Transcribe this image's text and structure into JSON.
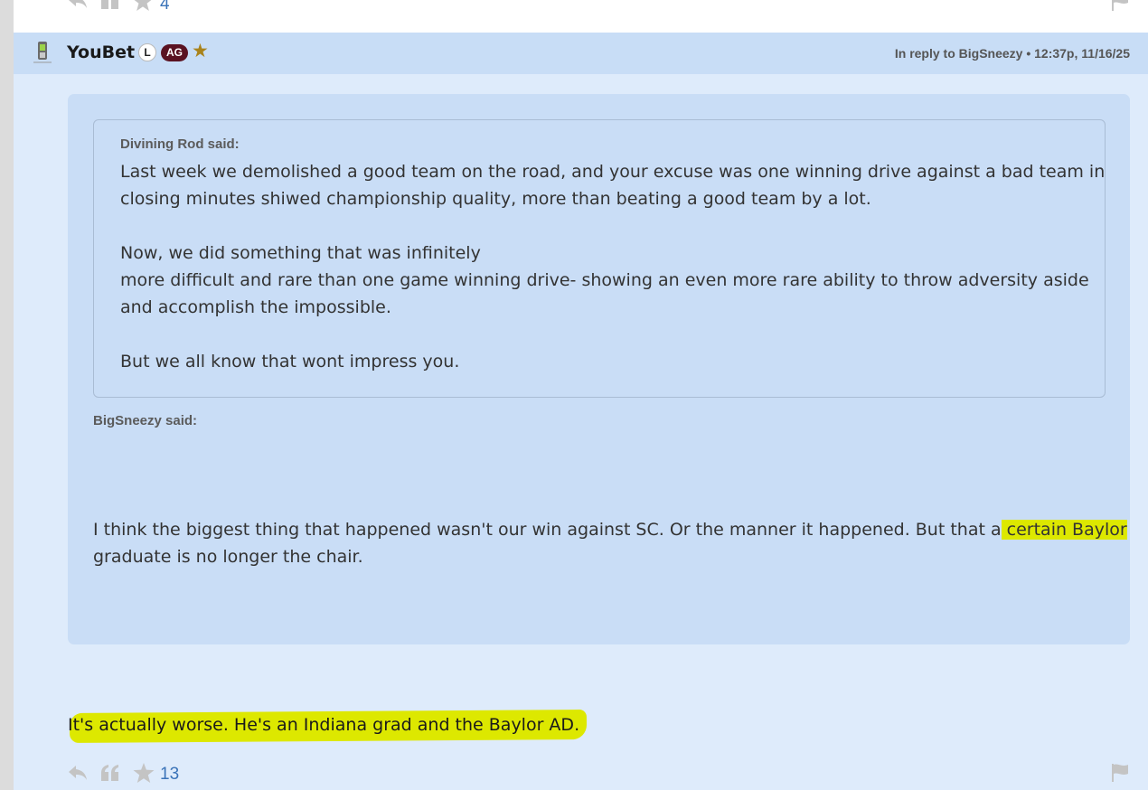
{
  "previous_post": {
    "like_count": "4"
  },
  "post": {
    "username": "YouBet",
    "badge_l": "L",
    "badge_ag": "AG",
    "meta": "In reply to BigSneezy • 12:37p, 11/16/25",
    "inner_quote": {
      "author_said": "Divining Rod said:",
      "lines": [
        "Last week we demolished a good team on the road, and your excuse was one winning drive against a bad team in",
        "closing minutes shiwed championship quality, more than beating a good team by a lot.",
        "Now, we did something that was infinitely",
        "more difficult and rare than one game winning drive- showing an even more rare ability to throw adversity aside",
        "and accomplish the impossible.",
        "But we all know that wont impress you."
      ]
    },
    "outer_quote": {
      "author_said": "BigSneezy said:",
      "line1_pre": "I think the biggest thing that happened wasn't our win against SC. Or the manner it happened. But that a",
      "line1_hl": " certain Baylor",
      "line2": "graduate is no longer the chair."
    },
    "reply": "It's actually worse. He's an Indiana grad and the Baylor AD.",
    "like_count": "13"
  },
  "icons": {
    "reply": "reply-arrow-icon",
    "quote": "quote-icon",
    "like": "star-icon",
    "flag": "flag-icon",
    "device": "mobile-phone-icon"
  },
  "colors": {
    "highlight": "#dde800",
    "header_bg": "#c8ddf6",
    "page_bg": "#deebfb",
    "ag_badge": "#5a1221",
    "star_gold": "#a9831c",
    "link_blue": "#3a73b8"
  }
}
